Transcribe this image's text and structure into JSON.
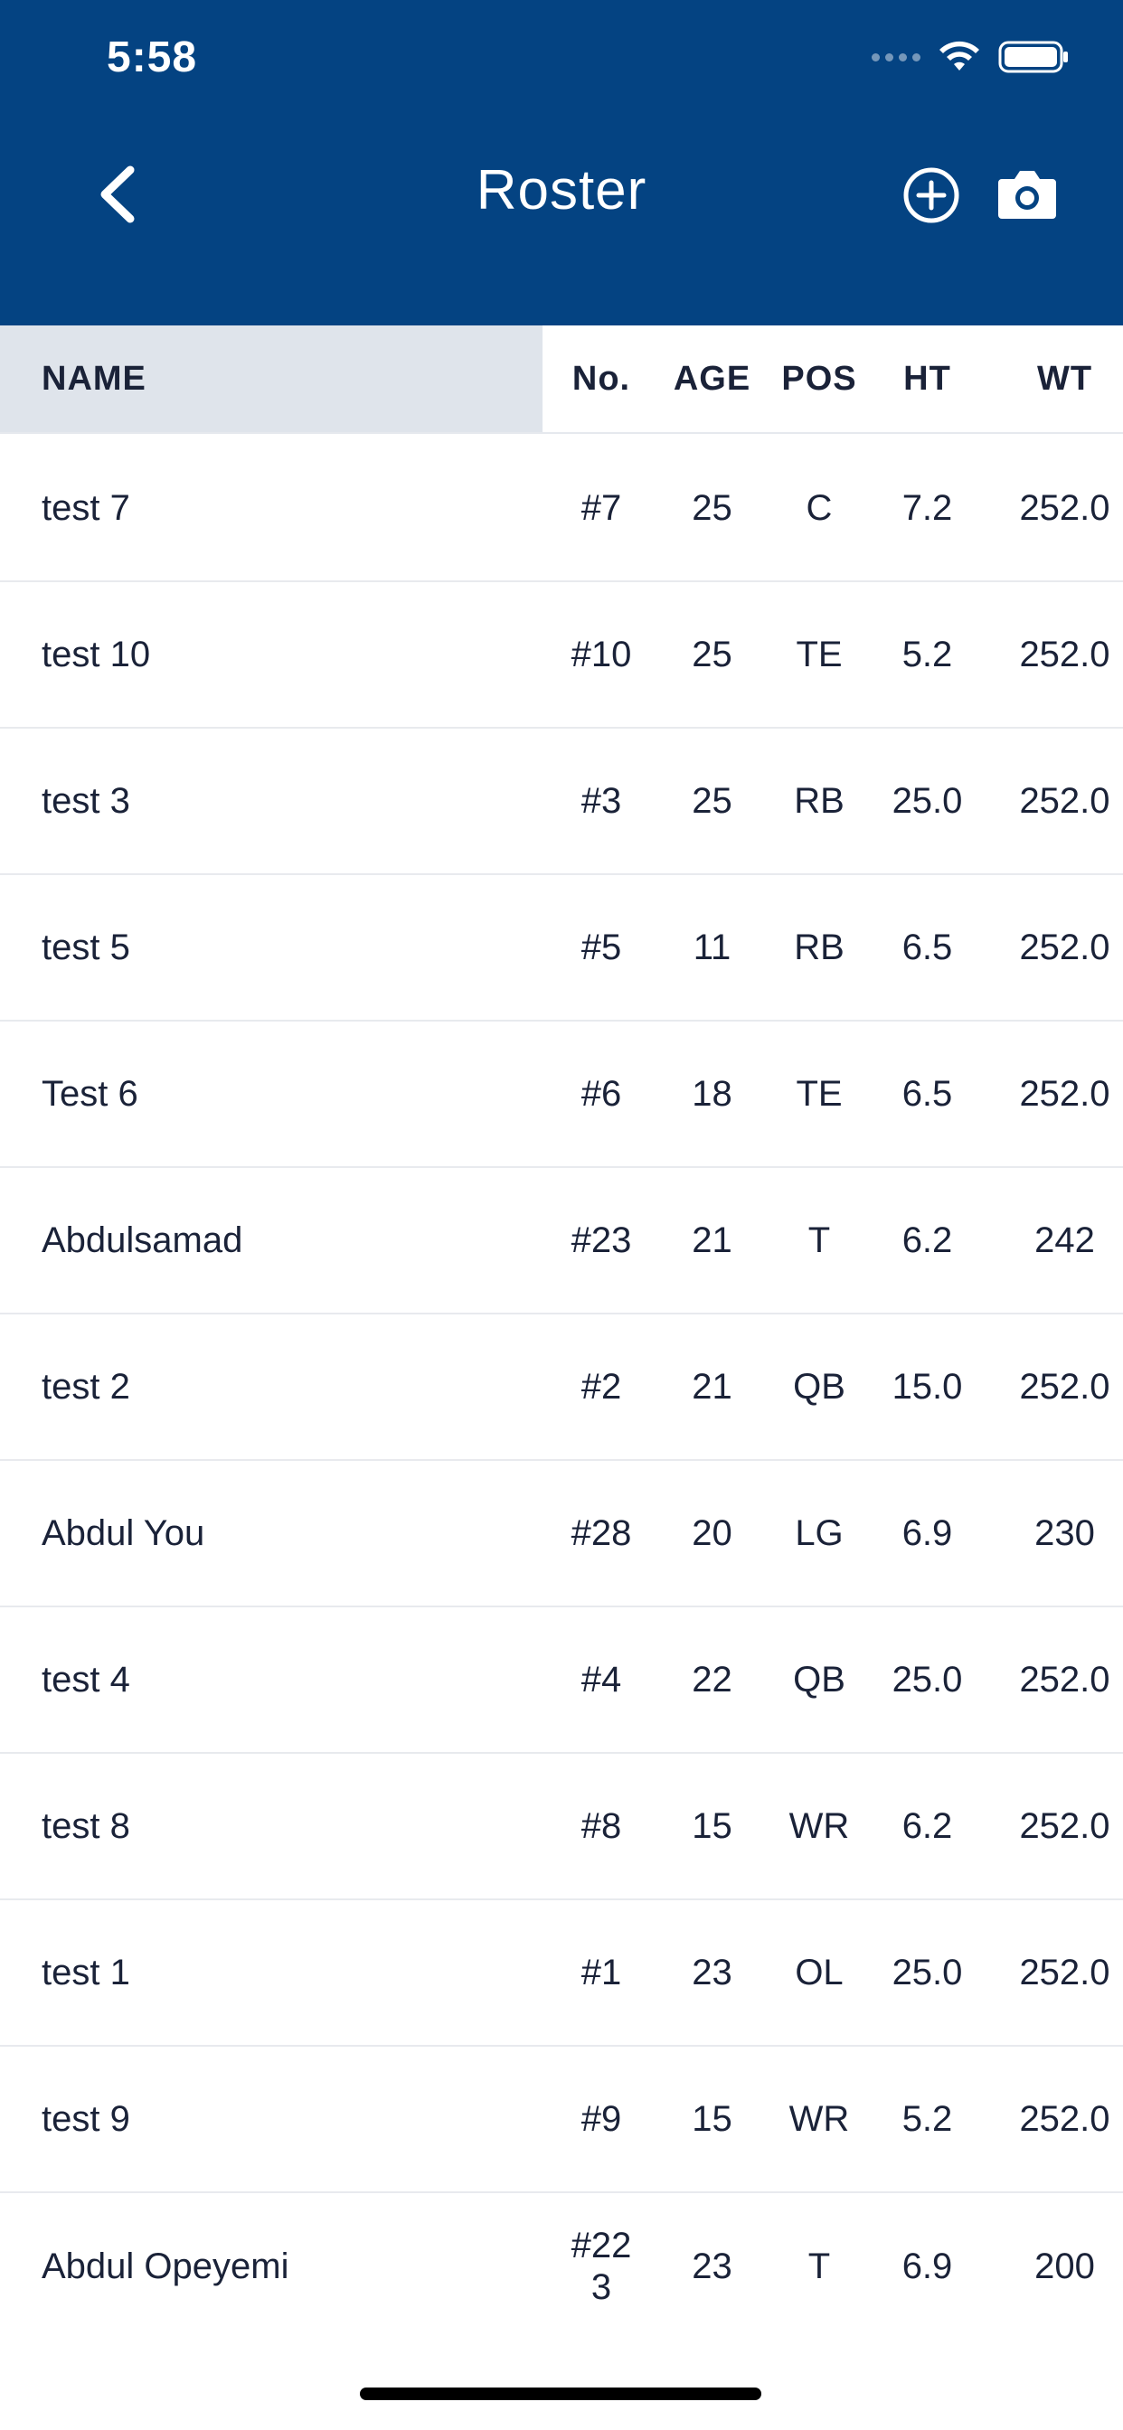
{
  "status_bar": {
    "time": "5:58"
  },
  "header": {
    "title": "Roster"
  },
  "columns": {
    "name": "NAME",
    "no": "No.",
    "age": "AGE",
    "pos": "POS",
    "ht": "HT",
    "wt": "WT"
  },
  "rows": [
    {
      "name": "test 7",
      "no": "#7",
      "age": "25",
      "pos": "C",
      "ht": "7.2",
      "wt": "252.0"
    },
    {
      "name": "test 10",
      "no": "#10",
      "age": "25",
      "pos": "TE",
      "ht": "5.2",
      "wt": "252.0"
    },
    {
      "name": "test 3",
      "no": "#3",
      "age": "25",
      "pos": "RB",
      "ht": "25.0",
      "wt": "252.0"
    },
    {
      "name": "test 5",
      "no": "#5",
      "age": "11",
      "pos": "RB",
      "ht": "6.5",
      "wt": "252.0"
    },
    {
      "name": "Test 6",
      "no": "#6",
      "age": "18",
      "pos": "TE",
      "ht": "6.5",
      "wt": "252.0"
    },
    {
      "name": "Abdulsamad",
      "no": "#23",
      "age": "21",
      "pos": "T",
      "ht": "6.2",
      "wt": "242"
    },
    {
      "name": "test 2",
      "no": "#2",
      "age": "21",
      "pos": "QB",
      "ht": "15.0",
      "wt": "252.0"
    },
    {
      "name": "Abdul You",
      "no": "#28",
      "age": "20",
      "pos": "LG",
      "ht": "6.9",
      "wt": "230"
    },
    {
      "name": "test 4",
      "no": "#4",
      "age": "22",
      "pos": "QB",
      "ht": "25.0",
      "wt": "252.0"
    },
    {
      "name": "test 8",
      "no": "#8",
      "age": "15",
      "pos": "WR",
      "ht": "6.2",
      "wt": "252.0"
    },
    {
      "name": "test 1",
      "no": "#1",
      "age": "23",
      "pos": "OL",
      "ht": "25.0",
      "wt": "252.0"
    },
    {
      "name": "test 9",
      "no": "#9",
      "age": "15",
      "pos": "WR",
      "ht": "5.2",
      "wt": "252.0"
    },
    {
      "name": "Abdul Opeyemi",
      "no": "#223",
      "age": "23",
      "pos": "T",
      "ht": "6.9",
      "wt": "200"
    }
  ]
}
